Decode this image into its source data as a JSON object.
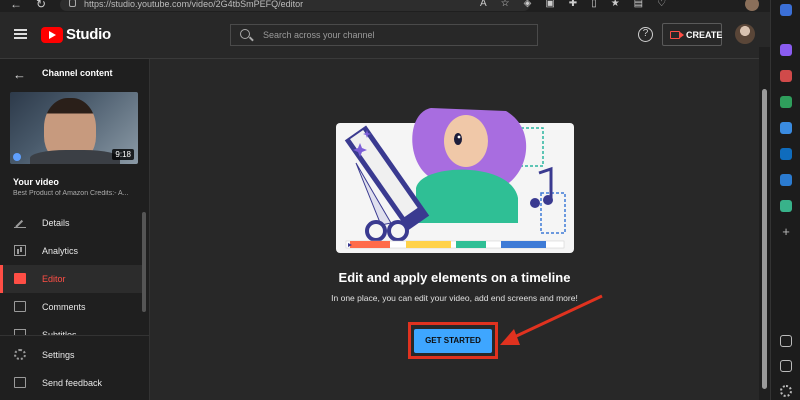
{
  "browser": {
    "url": "https://studio.youtube.com/video/2G4tbSmPEFQ/editor"
  },
  "header": {
    "logo_text": "Studio",
    "search_placeholder": "Search across your channel",
    "create_label": "CREATE"
  },
  "sidebar": {
    "title": "Channel content",
    "video_duration": "9:18",
    "video_title": "Your video",
    "video_subtitle": "Best Product of Amazon Credits:- A...",
    "items": [
      {
        "label": "Details",
        "icon": "pencil-icon",
        "active": false
      },
      {
        "label": "Analytics",
        "icon": "analytics-icon",
        "active": false
      },
      {
        "label": "Editor",
        "icon": "editor-icon",
        "active": true
      },
      {
        "label": "Comments",
        "icon": "comments-icon",
        "active": false
      },
      {
        "label": "Subtitles",
        "icon": "subtitles-icon",
        "active": false
      }
    ],
    "bottom_items": [
      {
        "label": "Settings",
        "icon": "gear-icon"
      },
      {
        "label": "Send feedback",
        "icon": "feedback-icon"
      }
    ]
  },
  "main": {
    "headline": "Edit and apply elements on a timeline",
    "subline": "In one place, you can edit your video, add end screens and more!",
    "button_label": "GET STARTED"
  },
  "colors": {
    "accent_red": "#ff4e45",
    "button_blue": "#3ea6ff",
    "highlight_red": "#e0321f"
  }
}
